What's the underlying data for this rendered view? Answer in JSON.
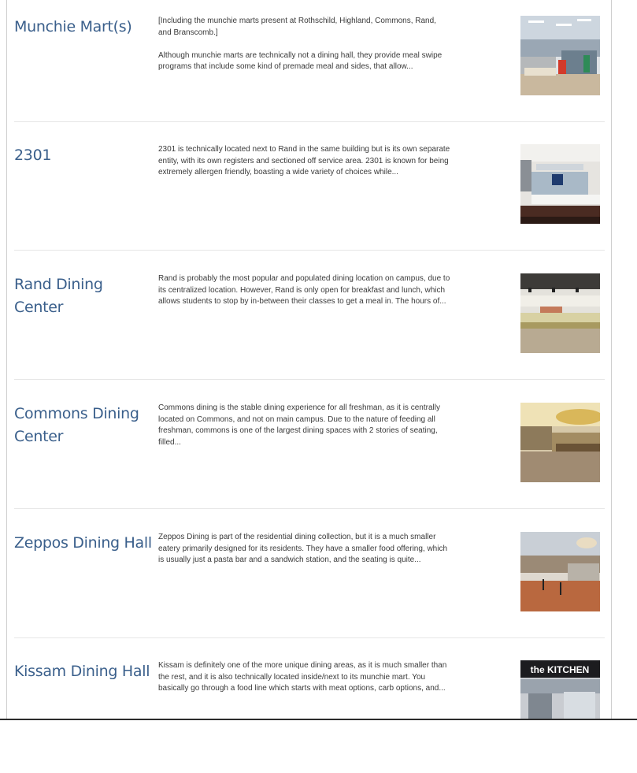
{
  "entries": [
    {
      "title": "Munchie Mart(s)",
      "note": "[Including the munchie marts present at Rothschild, Highland, Commons, Rand, and Branscomb.]",
      "excerpt": "Although munchie marts are technically not a dining hall, they provide meal swipe programs that include some kind of premade meal and sides, that allow..."
    },
    {
      "title": "2301",
      "note": "",
      "excerpt": "2301 is technically located next to Rand in the same building but is its own separate entity, with its own registers and sectioned off service area. 2301 is known for being extremely allergen friendly, boasting a wide variety of choices while..."
    },
    {
      "title": "Rand Dining Center",
      "note": "",
      "excerpt": "Rand is probably the most popular and populated dining location on campus, due to its centralized location. However, Rand is only open for breakfast and lunch, which allows students to stop by in-between their classes to get a meal in. The hours of..."
    },
    {
      "title": "Commons Dining Center",
      "note": "",
      "excerpt": "Commons dining is the stable dining experience for all freshman, as it is centrally located on Commons, and not on main campus. Due to the nature of feeding all freshman, commons is one of the largest dining spaces with 2 stories of seating, filled..."
    },
    {
      "title": "Zeppos Dining Hall",
      "note": "",
      "excerpt": "Zeppos Dining is part of the residential dining collection, but it is a much smaller eatery primarily designed for its residents. They have a smaller food offering, which is usually just a pasta bar and a sandwich station, and the seating is quite..."
    },
    {
      "title": "Kissam Dining Hall",
      "note": "",
      "excerpt": "Kissam is definitely one of the more unique dining areas, as it is much smaller than the rest, and it is also technically located inside/next to its munchie mart. You basically go through a food line which starts with meat options, carb options, and...",
      "sign_text": "the KITCHEN"
    }
  ]
}
